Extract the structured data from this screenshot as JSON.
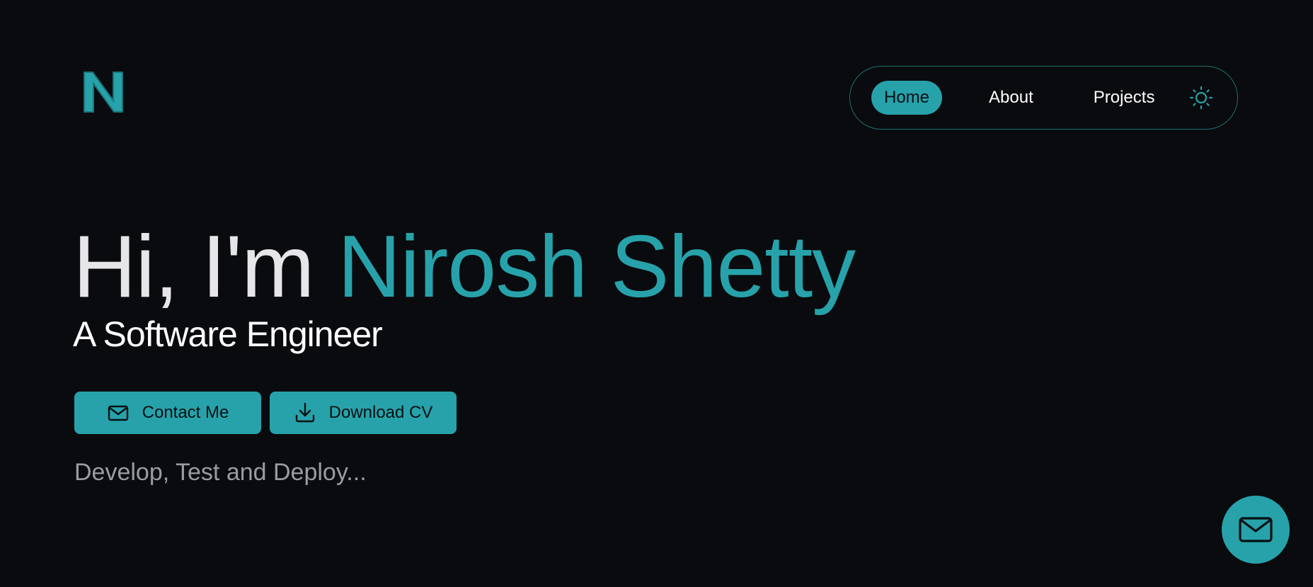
{
  "logo": {
    "letter": "N",
    "icon": "logo-n-icon"
  },
  "nav": {
    "items": [
      {
        "label": "Home",
        "active": true
      },
      {
        "label": "About",
        "active": false
      },
      {
        "label": "Projects",
        "active": false
      }
    ],
    "theme_toggle_icon": "sun-icon"
  },
  "hero": {
    "greeting": "Hi, I'm ",
    "name": "Nirosh Shetty",
    "subtitle": "A Software Engineer",
    "tagline": "Develop, Test and Deploy..."
  },
  "buttons": {
    "contact": {
      "label": "Contact Me",
      "icon": "mail-icon"
    },
    "download": {
      "label": "Download CV",
      "icon": "download-icon"
    }
  },
  "fab": {
    "icon": "mail-icon"
  },
  "colors": {
    "accent": "#27a2aa",
    "background": "#0a0b0e",
    "text_primary": "#ffffff",
    "text_muted": "#9a9ca3"
  }
}
